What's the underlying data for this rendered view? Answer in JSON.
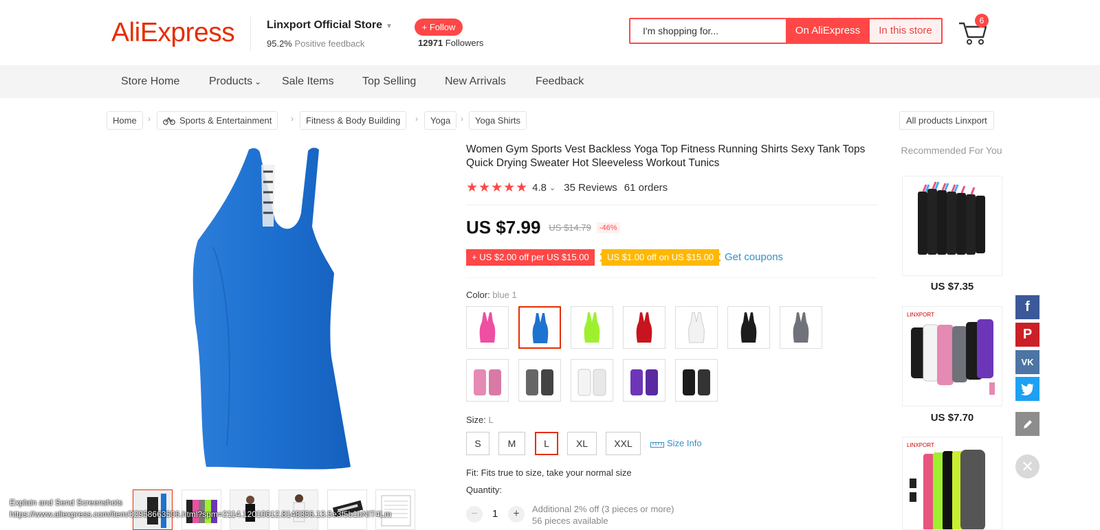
{
  "header": {
    "logo": "AliExpress",
    "store_name": "Linxport Official Store",
    "feedback_value": "95.2%",
    "feedback_label": "Positive feedback",
    "follow_label": "+ Follow",
    "followers_count": "12971",
    "followers_label": "Followers",
    "search_placeholder": "I'm shopping for...",
    "search_on_ali": "On AliExpress",
    "search_in_store": "In this store",
    "cart_count": "6"
  },
  "nav": {
    "items": [
      "Store Home",
      "Products",
      "Sale Items",
      "Top Selling",
      "New Arrivals",
      "Feedback"
    ]
  },
  "breadcrumb": {
    "items": [
      "Home",
      "Sports & Entertainment",
      "Fitness & Body Building",
      "Yoga",
      "Yoga Shirts"
    ],
    "all_products": "All products Linxport"
  },
  "product": {
    "title": "Women Gym Sports Vest Backless Yoga Top Fitness Running Shirts Sexy Tank Tops Quick Drying Sweater Hot Sleeveless Workout Tunics",
    "rating": "4.8",
    "reviews": "35 Reviews",
    "orders": "61 orders",
    "price": "US $7.99",
    "original_price": "US $14.79",
    "discount": "-46%",
    "coupon_1": "+ US $2.00 off per US $15.00",
    "coupon_2": "US $1.00 off on US $15.00",
    "get_coupons": "Get coupons",
    "color_label": "Color:",
    "color_value": "blue 1",
    "colors": [
      "#ee4fa3",
      "#1d73d0",
      "#9ef02f",
      "#c8141e",
      "#f2f2f2",
      "#1c1c1c",
      "#6f7278"
    ],
    "size_label": "Size:",
    "size_value": "L",
    "sizes": [
      "S",
      "M",
      "L",
      "XL",
      "XXL"
    ],
    "size_info": "Size Info",
    "fit": "Fit: Fits true to size, take your normal size",
    "quantity_label": "Quantity:",
    "quantity": "1",
    "qty_note_1": "Additional 2% off (3 pieces or more)",
    "qty_note_2": "56 pieces available"
  },
  "sidebar": {
    "recommended": "Recommended For You",
    "items": [
      {
        "price": "US $7.35"
      },
      {
        "price": "US $7.70"
      }
    ]
  },
  "overlay": {
    "line_1": "Explain and Send Screenshots",
    "line_2": "https://www.aliexpress.com/item/32958663506.html?spm=2114.12010612.8148356.13.5e3f5b1bNIT4Lm"
  }
}
